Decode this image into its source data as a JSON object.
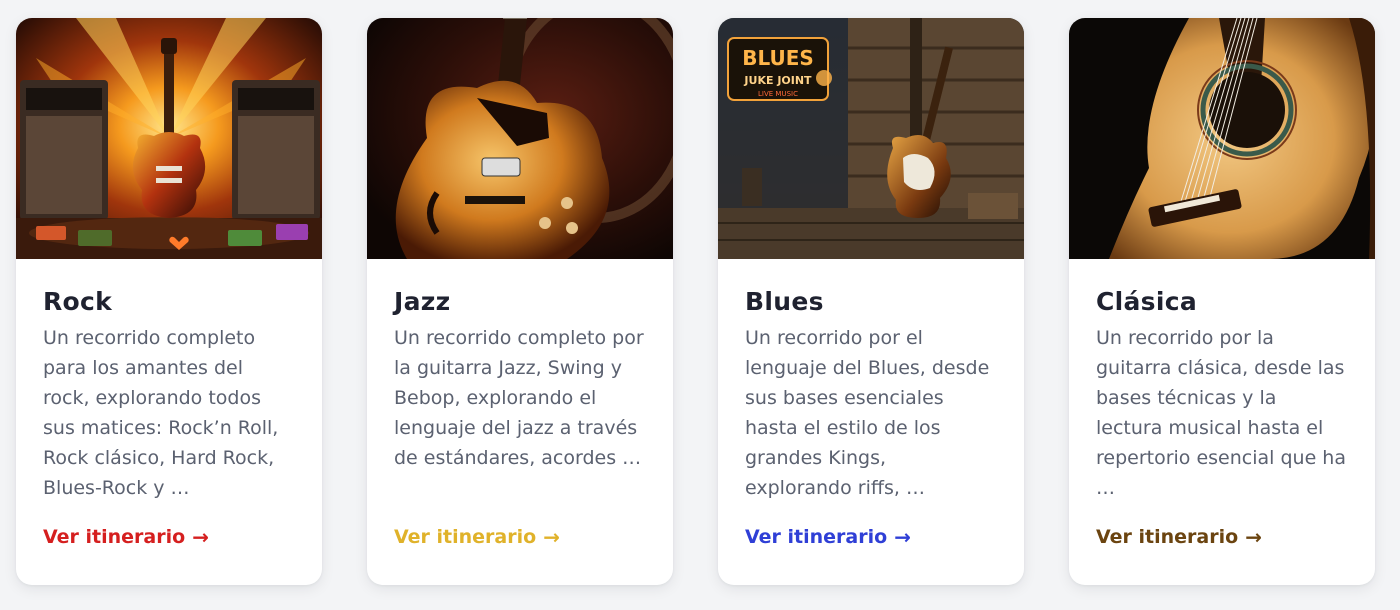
{
  "cards": [
    {
      "title": "Rock",
      "description": "Un recorrido completo para los amantes del rock, explorando todos sus matices: Rock’n Roll, Rock clásico, Hard Rock, Blues-Rock y …",
      "link_label": "Ver itinerario",
      "link_color": "#d51f1f",
      "image_icon": "rock-guitar-image"
    },
    {
      "title": "Jazz",
      "description": "Un recorrido completo por la guitarra Jazz, Swing y Bebop, explorando el lenguaje del jazz a través de estándares, acordes …",
      "link_label": "Ver itinerario",
      "link_color": "#e0b22a",
      "image_icon": "jazz-guitar-image"
    },
    {
      "title": "Blues",
      "description": "Un recorrido por el lenguaje del Blues, desde sus bases esenciales hasta el estilo de los grandes Kings, explorando riffs, …",
      "link_label": "Ver itinerario",
      "link_color": "#2f3fd6",
      "image_icon": "blues-guitar-image",
      "sign_title": "BLUES",
      "sign_sub": "JUKE JOINT",
      "sign_small": "LIVE MUSIC"
    },
    {
      "title": "Clásica",
      "description": "Un recorrido por la guitarra clásica, desde las bases técnicas y la lectura musical hasta el repertorio esencial que ha …",
      "link_label": "Ver itinerario",
      "link_color": "#6b4410",
      "image_icon": "classical-guitar-image"
    }
  ],
  "arrow_glyph": "→"
}
